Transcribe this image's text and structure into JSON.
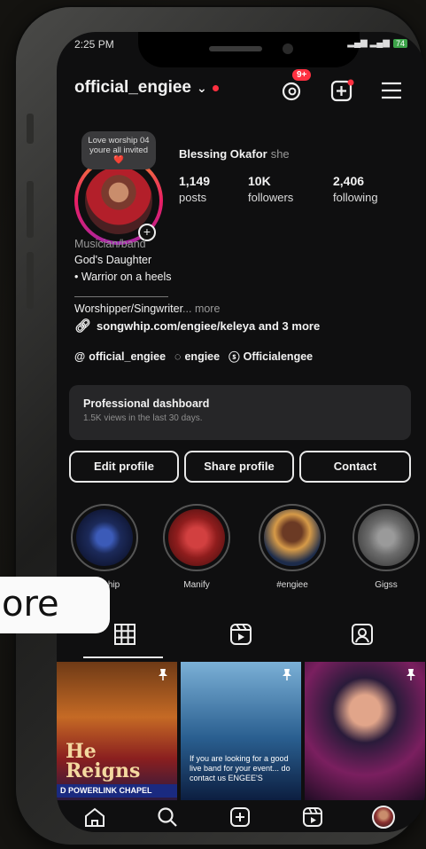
{
  "status": {
    "time": "2:25 PM",
    "battery": "74"
  },
  "profile": {
    "username": "official_engiee",
    "notifications_badge": "9+",
    "note": "Love worship 04 youre all invited ❤️",
    "full_name": "Blessing Okafor",
    "pronoun": "she",
    "stats": [
      {
        "value": "1,149",
        "label": "posts"
      },
      {
        "value": "10K",
        "label": "followers"
      },
      {
        "value": "2,406",
        "label": "following"
      }
    ],
    "category": "Musician/band",
    "bio_line1": "God's Daughter",
    "bio_line2": "• Warrior on a heels",
    "bio_line3": "Worshipper/Singwriter",
    "bio_more": "... more",
    "link_text": "songwhip.com/engiee/keleya and 3 more",
    "threads_handle": "official_engiee",
    "handle2": "engiee",
    "handle3": "Officialengee"
  },
  "dashboard": {
    "title": "Professional dashboard",
    "subtitle": "1.5K views in the last 30 days."
  },
  "buttons": {
    "edit": "Edit profile",
    "share": "Share profile",
    "contact": "Contact"
  },
  "highlights": [
    {
      "label": "worship",
      "color": "#1c2a5a"
    },
    {
      "label": "Manify",
      "color": "#8f1d1d"
    },
    {
      "label": "#engiee",
      "color": "#d69a48"
    },
    {
      "label": "Gigss",
      "color": "#6b6b6b"
    }
  ],
  "overlay": {
    "pill_text": "ore"
  },
  "posts": [
    {
      "caption": "He Reigns",
      "footer": "D POWERLINK CHAPEL"
    },
    {
      "caption": "If you are looking for a good live band for your event... do contact us ENGEE'S"
    },
    {
      "caption": ""
    }
  ]
}
